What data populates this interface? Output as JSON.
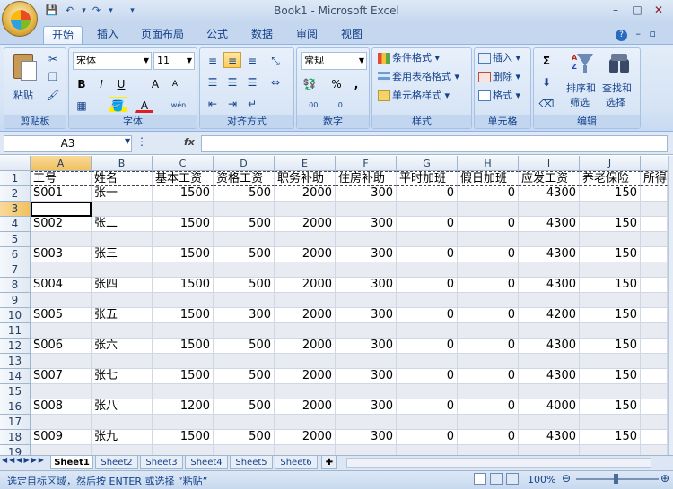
{
  "app_title": "Book1 - Microsoft Excel",
  "qat": {
    "save": "💾",
    "undo": "↶",
    "redo": "↷",
    "more": "▾"
  },
  "tabs": [
    "开始",
    "插入",
    "页面布局",
    "公式",
    "数据",
    "审阅",
    "视图"
  ],
  "ribbon": {
    "clipboard": {
      "label": "剪贴板",
      "paste": "粘贴"
    },
    "font": {
      "label": "字体",
      "font_name": "宋体",
      "font_size": "11",
      "bold": "B",
      "italic": "I",
      "underline": "U",
      "grow": "A",
      "shrink": "A",
      "font_color": "A",
      "wen": "wén"
    },
    "alignment": {
      "label": "对齐方式"
    },
    "number": {
      "label": "数字",
      "format": "常规",
      "percent": "%",
      "comma": ","
    },
    "styles": {
      "label": "样式",
      "conditional": "条件格式",
      "table": "套用表格格式",
      "cell_styles": "单元格样式"
    },
    "cells": {
      "label": "单元格",
      "insert": "插入",
      "delete": "删除",
      "format": "格式"
    },
    "editing": {
      "label": "编辑",
      "sort": "排序和",
      "sort2": "筛选",
      "find": "查找和",
      "find2": "选择",
      "sigma": "Σ"
    }
  },
  "formula_bar": {
    "name_box": "A3",
    "fx": "fx",
    "formula": ""
  },
  "columns": [
    "A",
    "B",
    "C",
    "D",
    "E",
    "F",
    "G",
    "H",
    "I",
    "J"
  ],
  "rows": [
    "1",
    "2",
    "3",
    "4",
    "5",
    "6",
    "7",
    "8",
    "9",
    "10",
    "11",
    "12",
    "13",
    "14",
    "15",
    "16",
    "17",
    "18",
    "19"
  ],
  "header_row": [
    "工号",
    "姓名",
    "基本工资",
    "资格工资",
    "职务补助",
    "住房补助",
    "平时加班",
    "假日加班",
    "应发工资",
    "养老保险",
    "所得"
  ],
  "records": [
    [
      "S001",
      "张一",
      "1500",
      "500",
      "2000",
      "300",
      "0",
      "0",
      "4300",
      "150"
    ],
    [
      "S002",
      "张二",
      "1500",
      "500",
      "2000",
      "300",
      "0",
      "0",
      "4300",
      "150"
    ],
    [
      "S003",
      "张三",
      "1500",
      "500",
      "2000",
      "300",
      "0",
      "0",
      "4300",
      "150"
    ],
    [
      "S004",
      "张四",
      "1500",
      "500",
      "2000",
      "300",
      "0",
      "0",
      "4300",
      "150"
    ],
    [
      "S005",
      "张五",
      "1500",
      "300",
      "2000",
      "300",
      "0",
      "0",
      "4200",
      "150"
    ],
    [
      "S006",
      "张六",
      "1500",
      "500",
      "2000",
      "300",
      "0",
      "0",
      "4300",
      "150"
    ],
    [
      "S007",
      "张七",
      "1500",
      "500",
      "2000",
      "300",
      "0",
      "0",
      "4300",
      "150"
    ],
    [
      "S008",
      "张八",
      "1200",
      "500",
      "2000",
      "300",
      "0",
      "0",
      "4000",
      "150"
    ],
    [
      "S009",
      "张九",
      "1500",
      "500",
      "2000",
      "300",
      "0",
      "0",
      "4300",
      "150"
    ]
  ],
  "sheets": [
    "Sheet1",
    "Sheet2",
    "Sheet3",
    "Sheet4",
    "Sheet5",
    "Sheet6"
  ],
  "active_sheet": "Sheet1",
  "status": {
    "text": "选定目标区域，然后按 ENTER 或选择 “粘贴”",
    "zoom": "100%"
  },
  "colors": {
    "accent": "#15428b",
    "ribbon": "#d6e4f5",
    "selection": "#f1c15f"
  }
}
